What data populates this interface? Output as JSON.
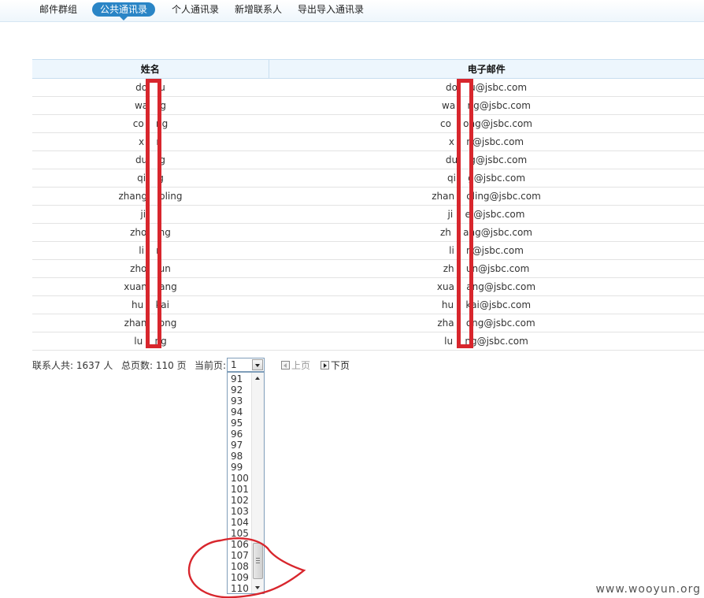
{
  "nav": {
    "items": [
      {
        "label": "邮件群组"
      },
      {
        "label": "公共通讯录",
        "active": true
      },
      {
        "label": "个人通讯录"
      },
      {
        "label": "新增联系人"
      },
      {
        "label": "导出导入通讯录"
      }
    ]
  },
  "table": {
    "headers": {
      "name": "姓名",
      "email": "电子邮件"
    },
    "rows": [
      {
        "name": "do    u",
        "email": "do    u@jsbc.com"
      },
      {
        "name": "wa    g",
        "email": "wa    ng@jsbc.com"
      },
      {
        "name": "co    ng",
        "email": "co    ong@jsbc.com"
      },
      {
        "name": "x    n",
        "email": "x    n@jsbc.com"
      },
      {
        "name": "du    g",
        "email": "du    g@jsbc.com"
      },
      {
        "name": "qi    g",
        "email": "qi    g@jsbc.com"
      },
      {
        "name": "zhang    oling",
        "email": "zhan    oling@jsbc.com"
      },
      {
        "name": "ji    i",
        "email": "ji    ei@jsbc.com"
      },
      {
        "name": "zho    ng",
        "email": "zh    ang@jsbc.com"
      },
      {
        "name": "li    n",
        "email": "li    n@jsbc.com"
      },
      {
        "name": "zho    un",
        "email": "zh    un@jsbc.com"
      },
      {
        "name": "xuan    ang",
        "email": "xua    ang@jsbc.com"
      },
      {
        "name": "hu    kai",
        "email": "hu    kai@jsbc.com"
      },
      {
        "name": "zhan    ong",
        "email": "zha    ong@jsbc.com"
      },
      {
        "name": "lu    ng",
        "email": "lu    ng@jsbc.com"
      }
    ]
  },
  "pager": {
    "total_label": "联系人共: 1637 人",
    "pages_label": "总页数: 110 页",
    "current_label": "当前页:",
    "current_value": "1",
    "prev_label": "上页",
    "next_label": "下页",
    "options": [
      "91",
      "92",
      "93",
      "94",
      "95",
      "96",
      "97",
      "98",
      "99",
      "100",
      "101",
      "102",
      "103",
      "104",
      "105",
      "106",
      "107",
      "108",
      "109",
      "110"
    ]
  },
  "colors": {
    "accent": "#2a85c6",
    "redact": "#d8262d"
  },
  "watermark": "www.wooyun.org"
}
